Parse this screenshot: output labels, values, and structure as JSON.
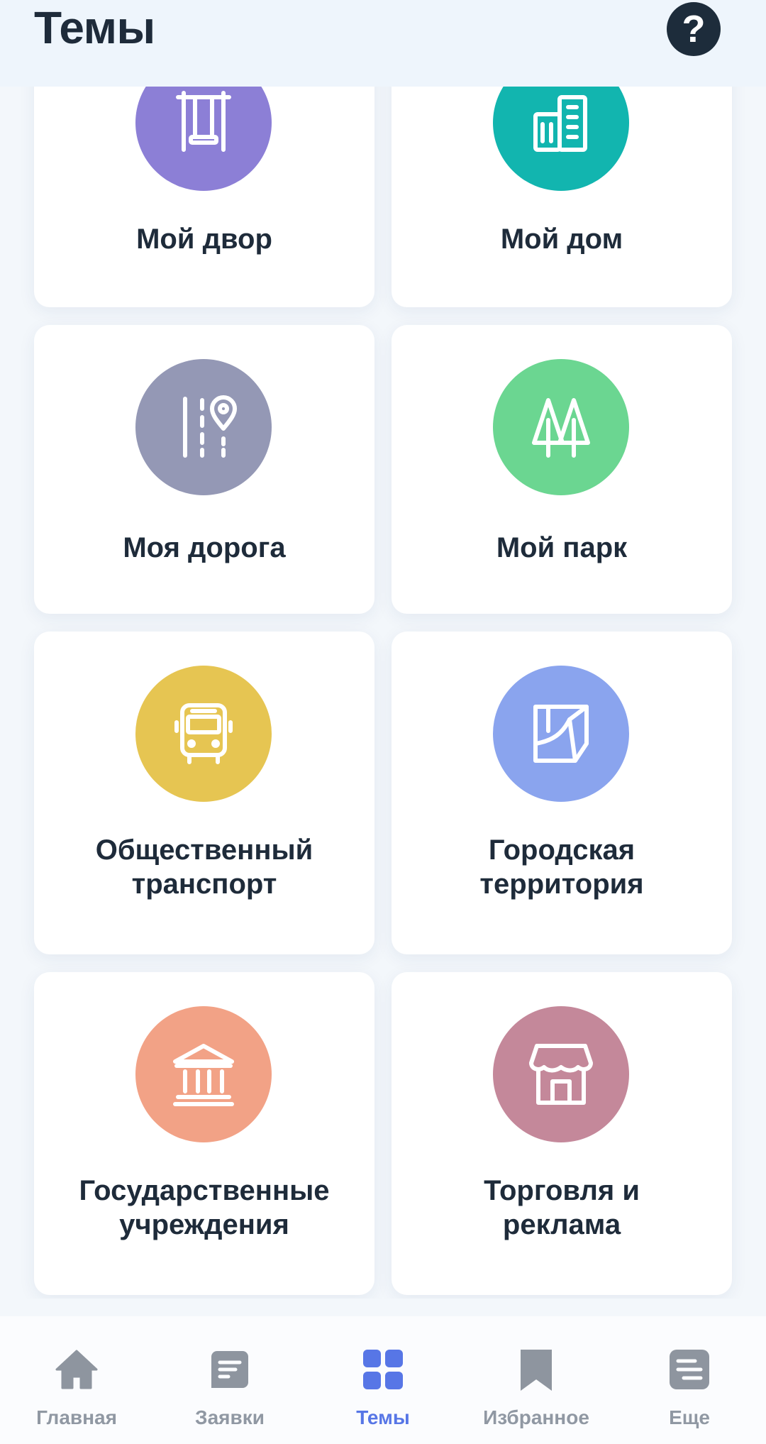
{
  "header": {
    "title": "Темы",
    "help_glyph": "?"
  },
  "topics": [
    {
      "label": "Мой двор",
      "color": "#8c7fd6",
      "icon": "swing-icon"
    },
    {
      "label": "Мой дом",
      "color": "#12b5af",
      "icon": "building-icon"
    },
    {
      "label": "Моя дорога",
      "color": "#9498b5",
      "icon": "road-pin-icon"
    },
    {
      "label": "Мой парк",
      "color": "#6bd691",
      "icon": "trees-icon"
    },
    {
      "label": "Общественный\nтранспорт",
      "color": "#e6c552",
      "icon": "bus-icon"
    },
    {
      "label": "Городская\nтерритория",
      "color": "#8aa4ee",
      "icon": "territory-icon"
    },
    {
      "label": "Государственные\nучреждения",
      "color": "#f2a286",
      "icon": "government-building-icon"
    },
    {
      "label": "Торговля и\nреклама",
      "color": "#c4889a",
      "icon": "shop-icon"
    }
  ],
  "nav": {
    "items": [
      {
        "label": "Главная",
        "icon": "home-icon"
      },
      {
        "label": "Заявки",
        "icon": "requests-icon"
      },
      {
        "label": "Темы",
        "icon": "grid-icon",
        "active": true
      },
      {
        "label": "Избранное",
        "icon": "bookmark-icon"
      },
      {
        "label": "Еще",
        "icon": "menu-lines-icon"
      }
    ],
    "active_color": "#5776e6",
    "inactive_color": "#9098a3"
  }
}
